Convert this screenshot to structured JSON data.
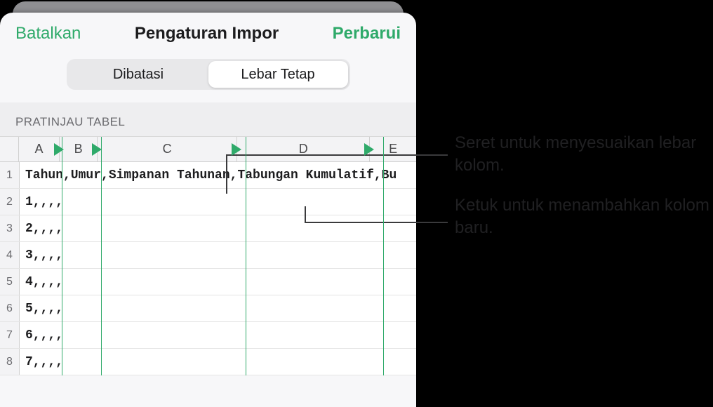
{
  "header": {
    "cancel": "Batalkan",
    "title": "Pengaturan Impor",
    "update": "Perbarui"
  },
  "segmented": {
    "options": [
      "Dibatasi",
      "Lebar Tetap"
    ],
    "active_index": 1
  },
  "section_label": "PRATINJAU TABEL",
  "columns": {
    "widths": [
      60,
      56,
      206,
      196,
      68
    ],
    "labels": [
      "A",
      "B",
      "C",
      "D",
      "E"
    ]
  },
  "rows": [
    {
      "n": "1",
      "text": "Tahun,Umur,Simpanan Tahunan,Tabungan Kumulatif,Bu"
    },
    {
      "n": "2",
      "text": "1,,,,"
    },
    {
      "n": "3",
      "text": "2,,,,"
    },
    {
      "n": "4",
      "text": "3,,,,"
    },
    {
      "n": "5",
      "text": "4,,,,"
    },
    {
      "n": "6",
      "text": "5,,,,"
    },
    {
      "n": "7",
      "text": "6,,,,"
    },
    {
      "n": "8",
      "text": "7,,,,"
    }
  ],
  "callouts": {
    "resize": "Seret untuk menyesuaikan lebar kolom.",
    "add": "Ketuk untuk menambahkan kolom baru."
  }
}
